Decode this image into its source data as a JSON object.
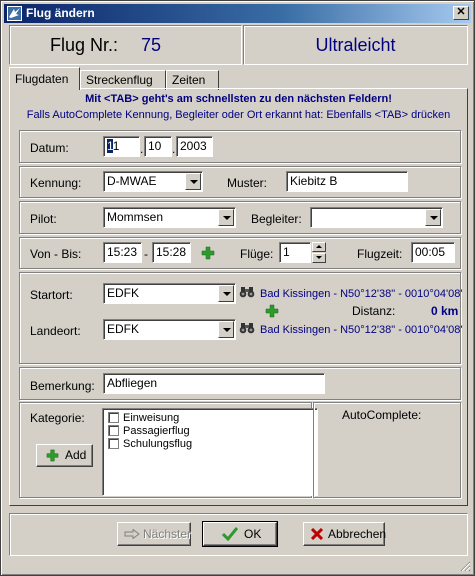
{
  "window": {
    "title": "Flug ändern"
  },
  "header": {
    "flight_no_label": "Flug Nr.:",
    "flight_no_value": "75",
    "type_label": "Ultraleicht"
  },
  "tabs": [
    {
      "label": "Flugdaten",
      "active": true
    },
    {
      "label": "Streckenflug",
      "active": false
    },
    {
      "label": "Zeiten",
      "active": false
    }
  ],
  "hints": {
    "line1": "Mit <TAB> geht's am schnellsten zu den nächsten Feldern!",
    "line2": "Falls AutoComplete Kennung, Begleiter oder Ort erkannt hat: Ebenfalls <TAB> drücken"
  },
  "date": {
    "label": "Datum:",
    "day_first_digit": "1",
    "day_rest": "1",
    "month": "10",
    "year": "2003"
  },
  "registration": {
    "label": "Kennung:",
    "value": "D-MWAE",
    "model_label": "Muster:",
    "model_value": "Kiebitz B"
  },
  "pilot": {
    "label": "Pilot:",
    "value": "Mommsen",
    "companion_label": "Begleiter:",
    "companion_value": ""
  },
  "times": {
    "label": "Von - Bis:",
    "from": "15:23",
    "separator": "-",
    "to": "15:28",
    "flights_label": "Flüge:",
    "flights_value": "1",
    "flight_time_label": "Flugzeit:",
    "flight_time_value": "00:05"
  },
  "route": {
    "start_label": "Startort:",
    "start_value": "EDFK",
    "start_location": "Bad Kissingen - N50°12'38\" - 0010°04'08'",
    "distance_label": "Distanz:",
    "distance_value": "0 km",
    "landing_label": "Landeort:",
    "landing_value": "EDFK",
    "landing_location": "Bad Kissingen - N50°12'38\" - 0010°04'08'"
  },
  "remark": {
    "label": "Bemerkung:",
    "value": "Abfliegen"
  },
  "category": {
    "label": "Kategorie:",
    "add_label": "Add",
    "items": [
      {
        "label": "Einweisung",
        "checked": false
      },
      {
        "label": "Passagierflug",
        "checked": false
      },
      {
        "label": "Schulungsflug",
        "checked": false
      }
    ],
    "autocomplete_label": "AutoComplete:"
  },
  "buttons": {
    "next_label": "Nächster",
    "ok_label": "OK",
    "cancel_label": "Abbrechen"
  },
  "colors": {
    "title_gradient_start": "#0a246a",
    "accent_blue": "#000080",
    "face": "#d4d0c8",
    "add_green": "#2e9a2e",
    "cancel_red": "#c00000"
  }
}
